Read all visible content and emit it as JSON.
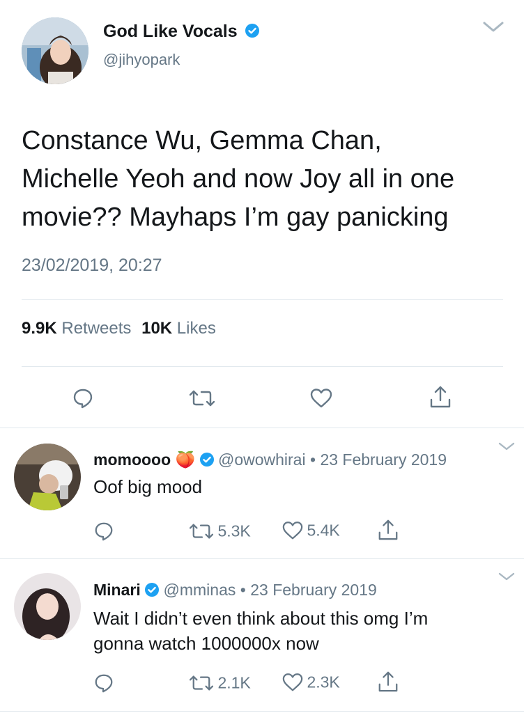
{
  "main_tweet": {
    "display_name": "God Like Vocals",
    "handle": "@jihyopark",
    "text_lines": [
      "Constance Wu, Gemma Chan,",
      "Michelle Yeoh and now Joy all in one",
      "movie?? Mayhaps I’m gay panicking"
    ],
    "timestamp": "23/02/2019, 20:27",
    "retweets_count": "9.9K",
    "retweets_label": "Retweets",
    "likes_count": "10K",
    "likes_label": "Likes"
  },
  "replies": [
    {
      "display_name": "momoooo",
      "emoji": "🍑",
      "handle": "@owowhirai",
      "separator": "•",
      "date": "23 February 2019",
      "text_lines": [
        "Oof big mood"
      ],
      "retweets": "5.3K",
      "likes": "5.4K"
    },
    {
      "display_name": "Minari",
      "handle": "@mminas",
      "separator": "•",
      "date": "23 February 2019",
      "text_lines": [
        "Wait I didn’t even think about this omg I’m",
        "gonna watch 1000000x now"
      ],
      "retweets": "2.1K",
      "likes": "2.3K"
    }
  ],
  "colors": {
    "verified_blue": "#1da1f2",
    "grey_text": "#657786",
    "divider": "#e1e8ed",
    "icon_grey": "#657786"
  },
  "icons": [
    "chevron-down-icon",
    "verified-badge-icon",
    "reply-icon",
    "retweet-icon",
    "like-icon",
    "share-icon"
  ]
}
